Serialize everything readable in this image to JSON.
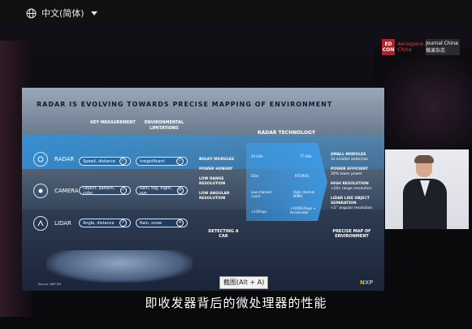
{
  "topbar": {
    "language_label": "中文(简体)"
  },
  "logos": {
    "edicon": "ED CON",
    "aw": "Aerospace China",
    "ww": "Journal China 微波杂志"
  },
  "slide": {
    "title": "RADAR IS EVOLVING TOWARDS PRECISE MAPPING OF ENVIRONMENT",
    "col_key": "KEY MEASUREMENT",
    "col_env": "ENVIRONMENTAL LIMITATIONS",
    "rows": [
      {
        "label": "RADAR",
        "key": "Speed, distance",
        "env": "Insignificant",
        "env_icon": "✓"
      },
      {
        "label": "CAMERA",
        "key": "Object, pattern, color",
        "env": "Rain, fog, night, sun",
        "env_icon": "✕"
      },
      {
        "label": "LIDAR",
        "key": "Angle, distance",
        "env": "Rain, snow",
        "env_icon": "✕"
      }
    ],
    "tech_title": "RADAR TECHNOLOGY",
    "left_list": [
      "BULKY MODULES",
      "POWER HUNGRY",
      "LOW RANGE RESOLUTION",
      "LOW ANGULAR RESOLUTION"
    ],
    "cells": [
      {
        "l": "24 GHz",
        "r": "77 GHz"
      },
      {
        "l": "SiGe",
        "r": "RFCMOS"
      },
      {
        "l": "Low channel count",
        "r": "High channel MIMO"
      },
      {
        "l": "<1GFlops",
        "r": ">1000GFlops + Accelerator"
      }
    ],
    "right_list": [
      "SMALL MODULES",
      "3x smaller antennas",
      "POWER EFFICIENT",
      "30% lower power",
      "HIGH RESOLUTION",
      "<20x range resolution",
      "LIDAR LIKE OBJECT SEPARATION",
      "<1° angular resolution"
    ],
    "bottom_left": "DETECTING A CAR",
    "bottom_right": "PRECISE MAP OF ENVIRONMENT",
    "source": "Source: NXP GM",
    "brand": [
      "N",
      "X",
      "P"
    ]
  },
  "tooltip": {
    "text": "截图(Alt + A)"
  },
  "subtitle": {
    "text": "即收发器背后的微处理器的性能"
  }
}
